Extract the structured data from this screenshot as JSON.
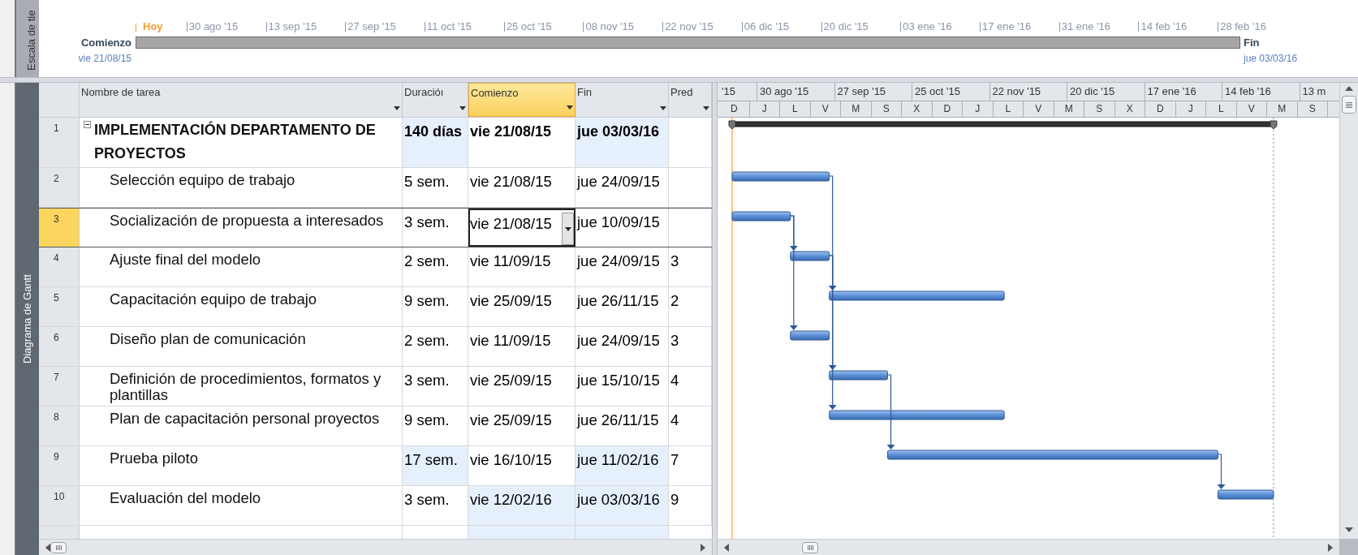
{
  "view_bar": {
    "timeline_label": "Escala de tie",
    "gantt_label": "Diagrama de Gantt"
  },
  "timeline": {
    "today_label": "Hoy",
    "ticks": [
      "30 ago '15",
      "13 sep '15",
      "27 sep '15",
      "11 oct '15",
      "25 oct '15",
      "08 nov '15",
      "22 nov '15",
      "06 dic '15",
      "20 dic '15",
      "03 ene '16",
      "17 ene '16",
      "31 ene '16",
      "14 feb '16",
      "28 feb '16"
    ],
    "start_label": "Comienzo",
    "start_date": "vie 21/08/15",
    "finish_label": "Fin",
    "finish_date": "jue 03/03/16"
  },
  "table": {
    "columns": [
      {
        "label": "Nombre de tarea",
        "selected": false
      },
      {
        "label": "Duracióı",
        "selected": false
      },
      {
        "label": "Comienzo",
        "selected": true
      },
      {
        "label": "Fin",
        "selected": false
      },
      {
        "label": "Pred",
        "selected": false
      }
    ],
    "rows": [
      {
        "id": "1",
        "kind": "summary",
        "expanded": true,
        "selected": false,
        "cells": [
          {
            "text": "IMPLEMENTACIÓN DEPARTAMENTO DE PROYECTOS",
            "changed": false,
            "editing": false
          },
          {
            "text": "140 días",
            "changed": true,
            "editing": false
          },
          {
            "text": "vie 21/08/15",
            "changed": false,
            "editing": false
          },
          {
            "text": "jue 03/03/16",
            "changed": true,
            "editing": false
          },
          {
            "changed": false,
            "editing": false
          }
        ]
      },
      {
        "id": "2",
        "kind": "task",
        "selected": false,
        "cells": [
          {
            "text": "Selección equipo de trabajo",
            "changed": false,
            "editing": false
          },
          {
            "text": "5 sem.",
            "changed": false,
            "editing": false
          },
          {
            "text": "vie 21/08/15",
            "changed": false,
            "editing": false
          },
          {
            "text": "jue 24/09/15",
            "changed": false,
            "editing": false
          },
          {
            "changed": false,
            "editing": false
          }
        ]
      },
      {
        "id": "3",
        "kind": "task",
        "selected": true,
        "cells": [
          {
            "text": "Socialización de propuesta a interesados",
            "changed": false,
            "editing": false
          },
          {
            "text": "3 sem.",
            "changed": false,
            "editing": false
          },
          {
            "text": "vie 21/08/15",
            "changed": false,
            "editing": true
          },
          {
            "text": "jue 10/09/15",
            "changed": false,
            "editing": false
          },
          {
            "changed": false,
            "editing": false
          }
        ]
      },
      {
        "id": "4",
        "kind": "task",
        "selected": false,
        "cells": [
          {
            "text": "Ajuste final del modelo",
            "changed": false,
            "editing": false
          },
          {
            "text": "2 sem.",
            "changed": false,
            "editing": false
          },
          {
            "text": "vie 11/09/15",
            "changed": false,
            "editing": false
          },
          {
            "text": "jue 24/09/15",
            "changed": false,
            "editing": false
          },
          {
            "text": "3",
            "changed": false,
            "editing": false
          }
        ]
      },
      {
        "id": "5",
        "kind": "task",
        "selected": false,
        "cells": [
          {
            "text": "Capacitación equipo de trabajo",
            "changed": false,
            "editing": false
          },
          {
            "text": "9 sem.",
            "changed": false,
            "editing": false
          },
          {
            "text": "vie 25/09/15",
            "changed": false,
            "editing": false
          },
          {
            "text": "jue 26/11/15",
            "changed": false,
            "editing": false
          },
          {
            "text": "2",
            "changed": false,
            "editing": false
          }
        ]
      },
      {
        "id": "6",
        "kind": "task",
        "selected": false,
        "cells": [
          {
            "text": "Diseño plan de comunicación",
            "changed": false,
            "editing": false
          },
          {
            "text": "2 sem.",
            "changed": false,
            "editing": false
          },
          {
            "text": "vie 11/09/15",
            "changed": false,
            "editing": false
          },
          {
            "text": "jue 24/09/15",
            "changed": false,
            "editing": false
          },
          {
            "text": "3",
            "changed": false,
            "editing": false
          }
        ]
      },
      {
        "id": "7",
        "kind": "task",
        "selected": false,
        "cells": [
          {
            "text": "Definición de procedimientos, formatos y plantillas",
            "changed": false,
            "editing": false
          },
          {
            "text": "3 sem.",
            "changed": false,
            "editing": false
          },
          {
            "text": "vie 25/09/15",
            "changed": false,
            "editing": false
          },
          {
            "text": "jue 15/10/15",
            "changed": false,
            "editing": false
          },
          {
            "text": "4",
            "changed": false,
            "editing": false
          }
        ]
      },
      {
        "id": "8",
        "kind": "task",
        "selected": false,
        "cells": [
          {
            "text": "Plan de capacitación personal proyectos",
            "changed": false,
            "editing": false
          },
          {
            "text": "9 sem.",
            "changed": false,
            "editing": false
          },
          {
            "text": "vie 25/09/15",
            "changed": false,
            "editing": false
          },
          {
            "text": "jue 26/11/15",
            "changed": false,
            "editing": false
          },
          {
            "text": "4",
            "changed": false,
            "editing": false
          }
        ]
      },
      {
        "id": "9",
        "kind": "task",
        "selected": false,
        "cells": [
          {
            "text": "Prueba piloto",
            "changed": false,
            "editing": false
          },
          {
            "text": "17 sem.",
            "changed": true,
            "editing": false
          },
          {
            "text": "vie 16/10/15",
            "changed": false,
            "editing": false
          },
          {
            "text": "jue 11/02/16",
            "changed": true,
            "editing": false
          },
          {
            "text": "7",
            "changed": false,
            "editing": false
          }
        ]
      },
      {
        "id": "10",
        "kind": "task",
        "selected": false,
        "cells": [
          {
            "text": "Evaluación del modelo",
            "changed": false,
            "editing": false
          },
          {
            "text": "3 sem.",
            "changed": false,
            "editing": false
          },
          {
            "text": "vie 12/02/16",
            "changed": true,
            "editing": false
          },
          {
            "text": "jue 03/03/16",
            "changed": true,
            "editing": false
          },
          {
            "text": "9",
            "changed": false,
            "editing": false
          }
        ]
      }
    ]
  },
  "gantt": {
    "timescale_top": [
      "'15",
      "30 ago '15",
      "27 sep '15",
      "25 oct '15",
      "22 nov '15",
      "20 dic '15",
      "17 ene '16",
      "14 feb '16",
      "13 m"
    ],
    "timescale_bottom": [
      "D",
      "J",
      "L",
      "V",
      "M",
      "S",
      "X",
      "D",
      "J",
      "L",
      "V",
      "M",
      "S",
      "X",
      "D",
      "J",
      "L",
      "V",
      "M",
      "S"
    ]
  }
}
